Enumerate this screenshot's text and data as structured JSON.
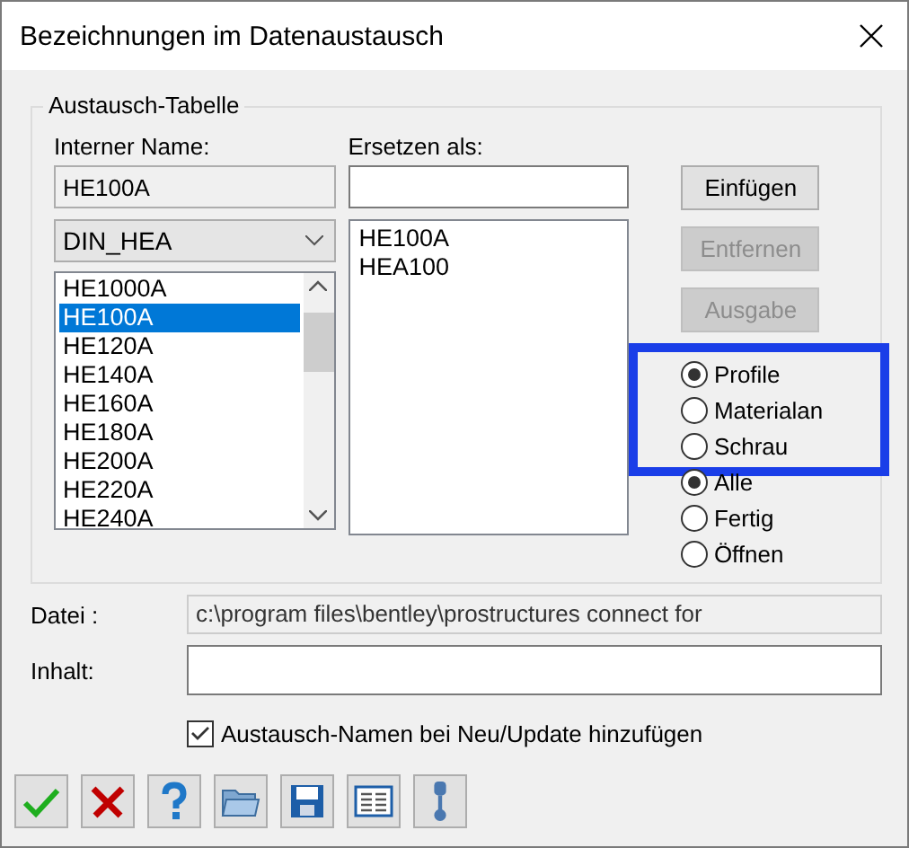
{
  "window": {
    "title": "Bezeichnungen im Datenaustausch"
  },
  "group": {
    "title": "Austausch-Tabelle",
    "internal_name": {
      "label": "Interner Name:",
      "value": "HE100A"
    },
    "replace_as": {
      "label": "Ersetzen als:"
    },
    "profile_table": {
      "value": "DIN_HEA"
    },
    "internal_list": [
      {
        "text": "HE1000A",
        "selected": false
      },
      {
        "text": "HE100A",
        "selected": true
      },
      {
        "text": "HE120A",
        "selected": false
      },
      {
        "text": "HE140A",
        "selected": false
      },
      {
        "text": "HE160A",
        "selected": false
      },
      {
        "text": "HE180A",
        "selected": false
      },
      {
        "text": "HE200A",
        "selected": false
      },
      {
        "text": "HE220A",
        "selected": false
      },
      {
        "text": "HE240A",
        "selected": false
      }
    ],
    "replace_list": [
      {
        "text": "HE100A",
        "selected": false
      },
      {
        "text": "HEA100",
        "selected": false
      }
    ],
    "buttons": [
      {
        "label": "Einfügen",
        "disabled": false
      },
      {
        "label": "Entfernen",
        "disabled": true
      },
      {
        "label": "Ausgabe",
        "disabled": true
      }
    ],
    "radio_groups": [
      {
        "options": [
          {
            "label": "Profile",
            "selected": true
          },
          {
            "label": "Materialan",
            "selected": false
          },
          {
            "label": "Schrau",
            "selected": false
          }
        ],
        "highlighted": true
      },
      {
        "options": [
          {
            "label": "Alle",
            "selected": true
          },
          {
            "label": "Fertig",
            "selected": false
          },
          {
            "label": "Öffnen",
            "selected": false
          }
        ]
      }
    ]
  },
  "file": {
    "label": "Datei :",
    "value": "c:\\program files\\bentley\\prostructures connect for"
  },
  "content": {
    "label": "Inhalt:"
  },
  "add_names": {
    "label": "Austausch-Namen bei Neu/Update hinzufügen",
    "checked": true
  },
  "toolbar": [
    {
      "kind": "check"
    },
    {
      "kind": "cross"
    },
    {
      "kind": "help"
    },
    {
      "kind": "folder"
    },
    {
      "kind": "save"
    },
    {
      "kind": "list"
    },
    {
      "kind": "pin"
    }
  ]
}
